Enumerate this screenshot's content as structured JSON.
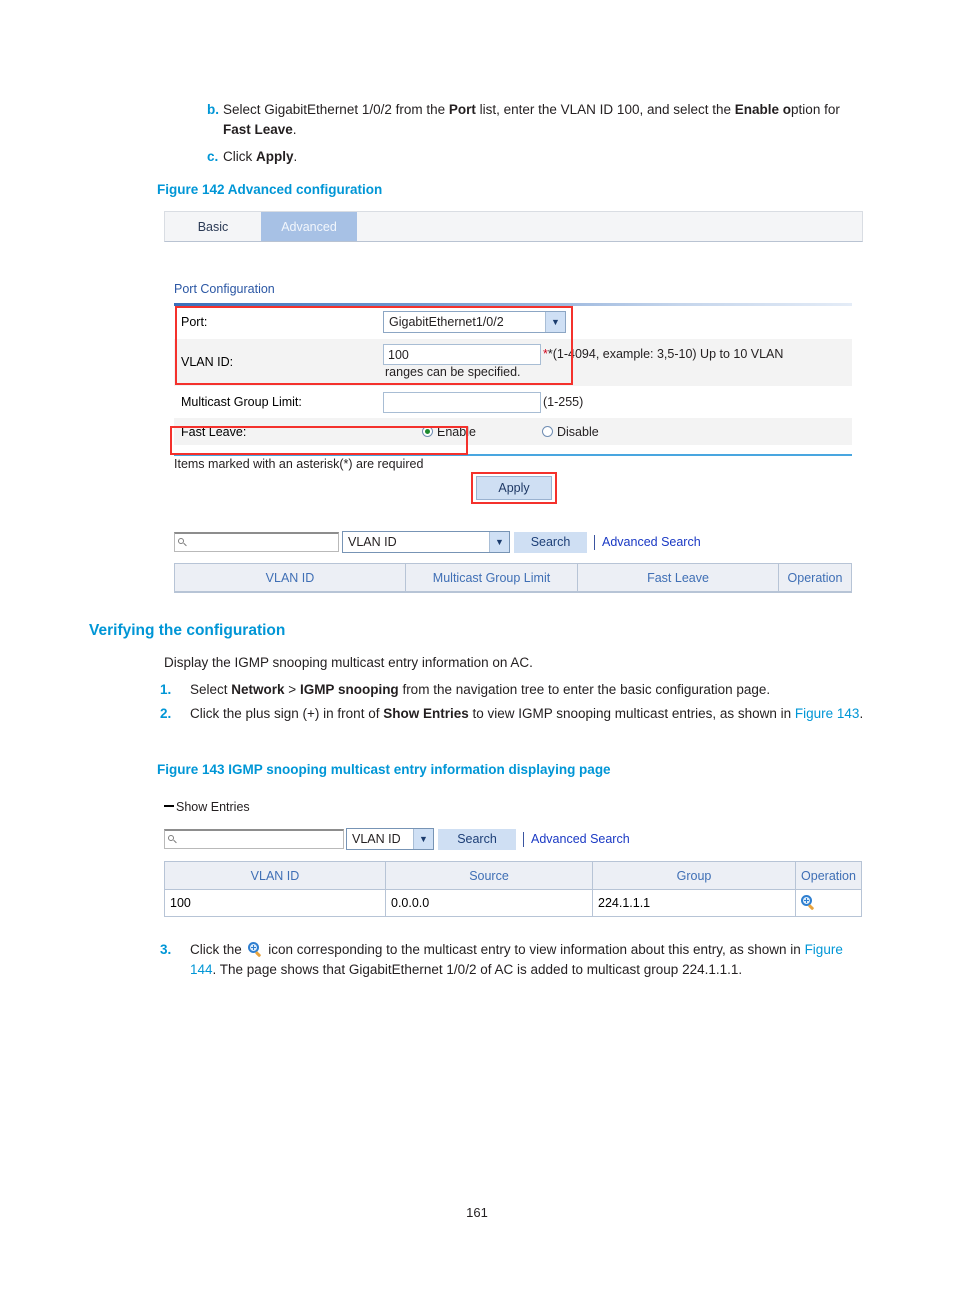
{
  "page": {
    "number": "161"
  },
  "steps_top": [
    {
      "marker": "b.",
      "parts": [
        {
          "t": "Select GigabitEthernet 1/0/2 from the ",
          "b": false
        },
        {
          "t": "Port",
          "b": true
        },
        {
          "t": " list, enter the VLAN ID 100, and select the ",
          "b": false
        },
        {
          "t": "Enable",
          "b": true
        },
        {
          "t": " o",
          "b": true
        },
        {
          "t": "ption for ",
          "b": false
        },
        {
          "t": "Fast Leave",
          "b": true
        },
        {
          "t": ".",
          "b": false
        }
      ]
    },
    {
      "marker": "c.",
      "parts": [
        {
          "t": "Click ",
          "b": false
        },
        {
          "t": "Apply",
          "b": true
        },
        {
          "t": ".",
          "b": false
        }
      ]
    }
  ],
  "figure142": {
    "caption": "Figure 142 Advanced configuration",
    "tabs": [
      {
        "label": "Basic",
        "selected": false
      },
      {
        "label": "Advanced",
        "selected": true
      }
    ],
    "section_title": "Port Configuration",
    "fields": {
      "port_label": "Port:",
      "port_value": "GigabitEthernet1/0/2",
      "vlan_label": "VLAN ID:",
      "vlan_value": "100",
      "vlan_hint_1": "*(1-4094, example: 3,5-10) Up to 10 VLAN",
      "vlan_hint_2": "ranges can be specified.",
      "mcast_label": "Multicast Group Limit:",
      "mcast_value": "",
      "mcast_hint": "(1-255)",
      "fastleave_label": "Fast Leave:",
      "fastleave_enable": "Enable",
      "fastleave_disable": "Disable",
      "fastleave_selected": "Enable"
    },
    "required_note": "Items marked with an asterisk(*) are required",
    "apply_label": "Apply",
    "search": {
      "input_value": "",
      "select_value": "VLAN ID",
      "button_label": "Search",
      "advanced_label": "Advanced Search"
    },
    "table": {
      "columns": [
        "VLAN ID",
        "Multicast Group Limit",
        "Fast Leave",
        "Operation"
      ],
      "rows": []
    }
  },
  "verifying": {
    "heading": "Verifying the configuration",
    "intro": "Display the IGMP snooping multicast entry information on AC.",
    "steps": [
      {
        "marker": "1.",
        "parts": [
          {
            "t": "Select ",
            "b": false
          },
          {
            "t": "Network",
            "b": true
          },
          {
            "t": " > ",
            "b": false
          },
          {
            "t": "IGMP snooping",
            "b": true
          },
          {
            "t": " from the navigation tree to enter the basic configuration page.",
            "b": false
          }
        ]
      },
      {
        "marker": "2.",
        "parts": [
          {
            "t": "Click the plus sign (+) in front of ",
            "b": false
          },
          {
            "t": "Show Entries",
            "b": true
          },
          {
            "t": " to view IGMP snooping multicast entries, as shown in ",
            "b": false
          },
          {
            "t": "Figure 143",
            "b": false,
            "link": true
          },
          {
            "t": ".",
            "b": false
          }
        ]
      }
    ]
  },
  "figure143": {
    "caption": "Figure 143 IGMP snooping multicast entry information displaying page",
    "show_entries_label": "Show Entries",
    "search": {
      "input_value": "",
      "select_value": "VLAN ID",
      "button_label": "Search",
      "advanced_label": "Advanced Search"
    },
    "table": {
      "columns": [
        "VLAN ID",
        "Source",
        "Group",
        "Operation"
      ],
      "rows": [
        {
          "vlan_id": "100",
          "source": "0.0.0.0",
          "group": "224.1.1.1",
          "operation": "zoom-in-icon"
        }
      ]
    }
  },
  "step3": {
    "marker": "3.",
    "parts_a": [
      {
        "t": "Click the ",
        "b": false
      }
    ],
    "parts_b": [
      {
        "t": " icon corresponding to the multicast entry to view information about this entry, as shown in ",
        "b": false
      },
      {
        "t": "Figure 144",
        "b": false,
        "link": true
      },
      {
        "t": ". The page shows that GigabitEthernet 1/0/2 of AC is added to multicast group 224.1.1.1.",
        "b": false
      }
    ]
  },
  "colors": {
    "hp_blue": "#0096d6",
    "annotation_red": "#f4312c",
    "tab_selected": "#a7c1e5",
    "table_header": "#eceff5",
    "link_blue": "#1a39c4"
  }
}
